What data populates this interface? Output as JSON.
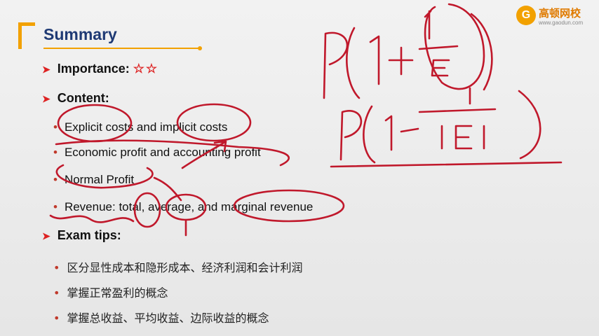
{
  "slide": {
    "title": "Summary",
    "importance_label": "Importance:",
    "importance_stars": "☆☆",
    "content_label": "Content:",
    "content_items": [
      "Explicit costs and implicit costs",
      "Economic profit and accounting profit",
      "Normal Profit",
      "Revenue: total, average, and marginal revenue"
    ],
    "exam_label": "Exam tips:",
    "exam_items": [
      "区分显性成本和隐形成本、经济利润和会计利润",
      "掌握正常盈利的概念",
      "掌握总收益、平均收益、边际收益的概念"
    ]
  },
  "logo": {
    "name": "高顿网校",
    "url": "www.gaodun.com"
  },
  "colors": {
    "accent": "#f2a100",
    "title": "#1f3a74",
    "ink": "#c0182b",
    "bullet": "#c0392b"
  },
  "icons": {
    "section_arrow": "arrow-right-icon",
    "list_bullet": "dot-icon",
    "logo": "gaodun-logo-icon"
  }
}
